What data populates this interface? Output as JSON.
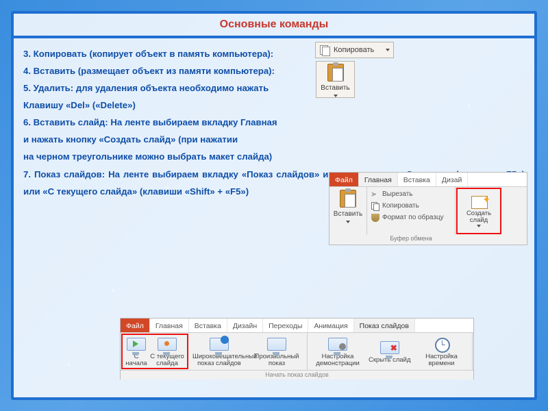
{
  "title": "Основные команды",
  "lines": {
    "l3": "3. Копировать (копирует объект в память компьютера):",
    "l4": "4. Вставить (размещает объект из памяти компьютера):",
    "l5": "5. Удалить: для удаления объекта необходимо нажать",
    "l5b": "Клавишу «Del» («Delete»)",
    "l6": "6. Вставить слайд: На ленте выбираем вкладку Главная",
    "l6b": "и нажать кнопку «Создать слайд» (при нажатии",
    "l6c": "на черном треугольнике можно выбрать макет слайда)",
    "l7": "7. Показ слайдов: На ленте выбираем вкладку «Показ слайдов» и нажать кнопку «С начала» (клавиша «F5») или «С текущего слайда» (клавиши «Shift» + «F5»)"
  },
  "copychip": {
    "label": "Копировать"
  },
  "pastechip": {
    "label": "Вставить"
  },
  "ribbon1": {
    "tabs": {
      "file": "Файл",
      "home": "Главная",
      "insert": "Вставка",
      "design": "Дизай"
    },
    "paste": "Вставить",
    "cut": "Вырезать",
    "copy": "Копировать",
    "format": "Формат по образцу",
    "group": "Буфер обмена",
    "newslide": "Создать слайд"
  },
  "ribbon2": {
    "tabs": {
      "file": "Файл",
      "home": "Главная",
      "insert": "Вставка",
      "design": "Дизайн",
      "trans": "Переходы",
      "anim": "Анимация",
      "show": "Показ слайдов"
    },
    "fromstart": "С начала",
    "fromcurrent": "С текущего слайда",
    "broadcast": "Широковещательный показ слайдов",
    "custom": "Произвольный показ",
    "setup": "Настройка демонстрации",
    "hide": "Скрыть слайд",
    "timing": "Настройка времени",
    "group": "Начать показ слайдов"
  }
}
